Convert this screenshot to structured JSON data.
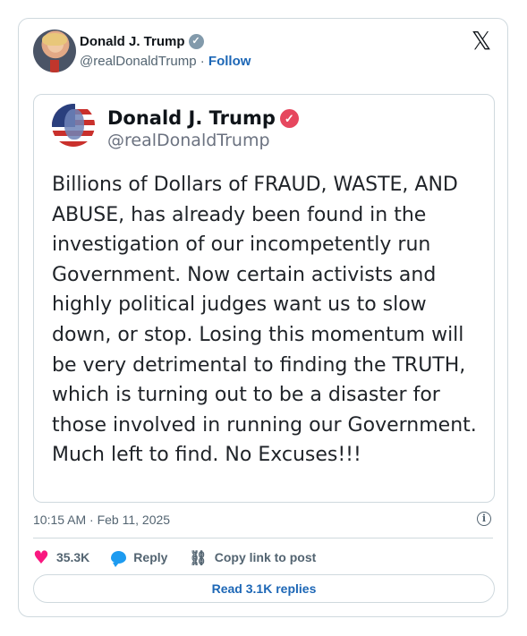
{
  "header": {
    "name": "Donald J. Trump",
    "handle": "@realDonaldTrump",
    "separator": "·",
    "follow": "Follow",
    "verified_icon": "verified-check-icon",
    "logo_icon": "x-logo-icon",
    "logo_glyph": "𝕏"
  },
  "embed": {
    "name": "Donald J. Trump",
    "handle": "@realDonaldTrump",
    "verified_icon": "verified-check-icon",
    "text": "Billions of Dollars of FRAUD, WASTE, AND ABUSE, has already been found in the investigation of our incompetently run Government. Now certain activists and highly political judges want us to slow down, or stop. Losing this momentum will be very detrimental to finding the TRUTH, which is turning out to be a disaster for those involved in running our Government. Much left to find. No Excuses!!!"
  },
  "meta": {
    "timestamp": "10:15 AM · Feb 11, 2025",
    "info_icon": "info-icon"
  },
  "actions": {
    "like_count": "35.3K",
    "reply_label": "Reply",
    "copy_label": "Copy link to post"
  },
  "footer": {
    "read_replies": "Read 3.1K replies"
  },
  "colors": {
    "accent": "#1d9bf0",
    "link": "#1d67b6",
    "like": "#f91880",
    "verified_red": "#e6475e",
    "verified_gray": "#829aab"
  }
}
